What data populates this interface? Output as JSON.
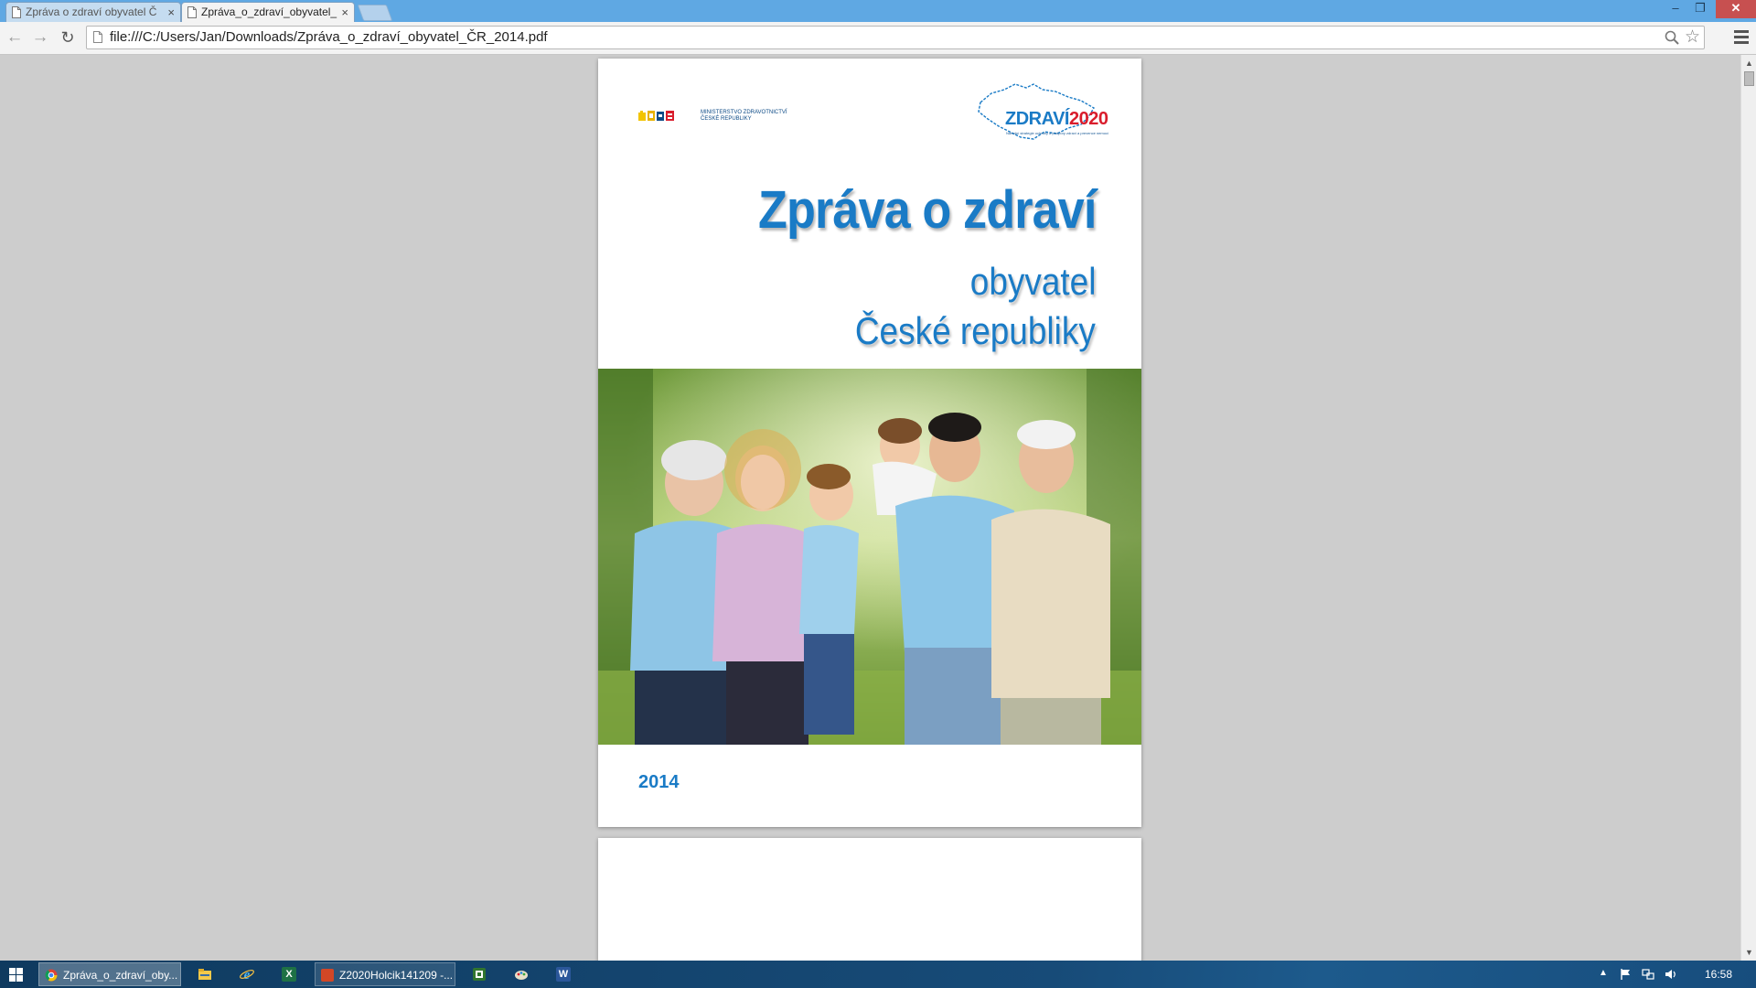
{
  "browser": {
    "tabs": [
      {
        "label": "Zpráva o zdraví obyvatel Č",
        "active": false
      },
      {
        "label": "Zpráva_o_zdraví_obyvatel_",
        "active": true
      }
    ],
    "close_glyph": "×",
    "window_controls": {
      "minimize": "–",
      "maximize": "❐",
      "close": "✕"
    },
    "nav": {
      "back": "←",
      "forward": "→",
      "reload": "↻"
    },
    "url": "file:///C:/Users/Jan/Downloads/Zpráva_o_zdraví_obyvatel_ČR_2014.pdf",
    "star": "☆"
  },
  "document": {
    "ministry_lines": [
      "MINISTERSTVO ZDRAVOTNICTVÍ",
      "ČESKÉ REPUBLIKY"
    ],
    "program_logo": {
      "part1": "ZDRAVÍ",
      "part2": "2020",
      "tagline": "Národní strategie ochrany a podpory zdraví a prevence nemocí"
    },
    "title": "Zpráva o zdraví",
    "subtitle_line1": "obyvatel",
    "subtitle_line2": "České republiky",
    "year": "2014",
    "accent_color": "#1a7bc6"
  },
  "scrollbar": {
    "up": "▲",
    "down": "▼"
  },
  "taskbar": {
    "chrome_label": "Zpráva_o_zdraví_oby...",
    "ppt_label": "Z2020Holcik141209 -...",
    "excel_letter": "X",
    "word_letter": "W",
    "tray_chevron": "▲",
    "clock": "16:58"
  }
}
